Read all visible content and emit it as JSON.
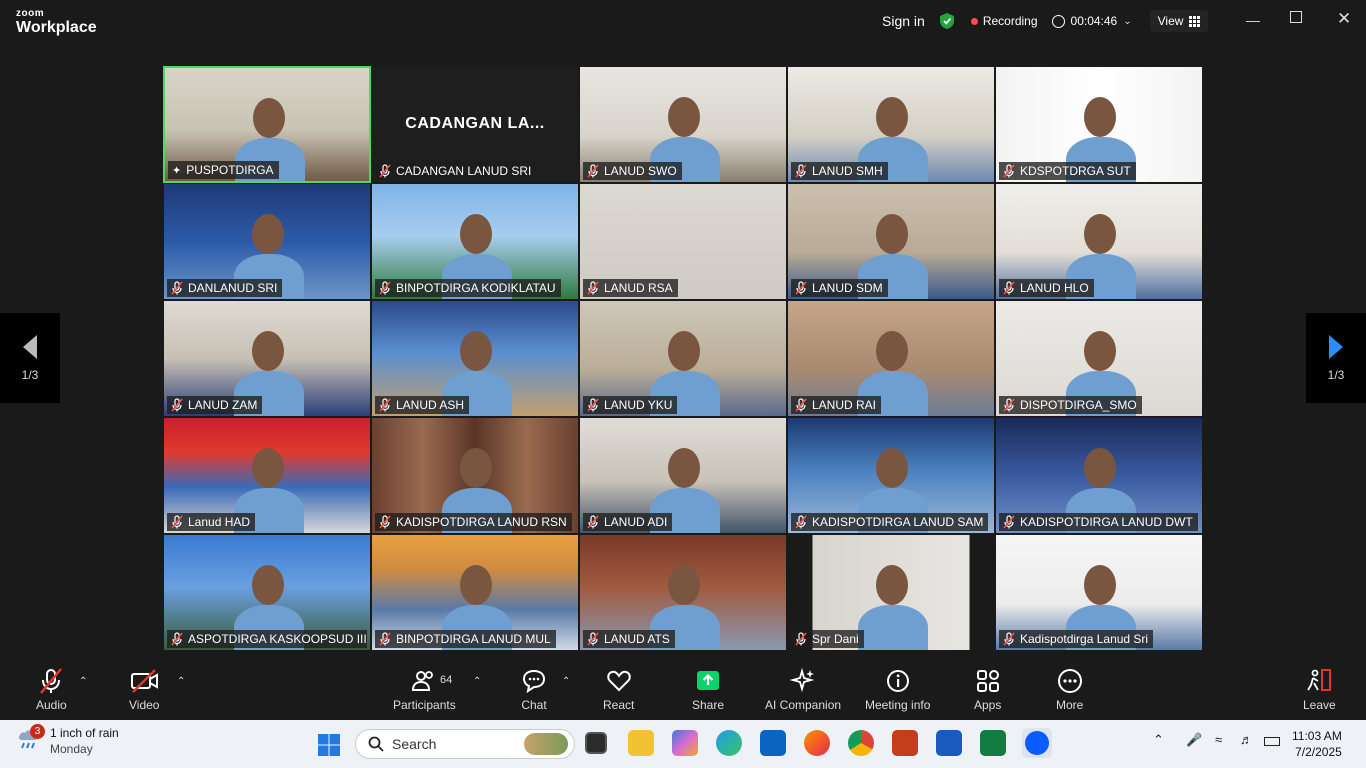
{
  "app": {
    "logo_top": "zoom",
    "logo_bottom": "Workplace"
  },
  "titlebar": {
    "sign_in": "Sign in",
    "recording": "Recording",
    "timer": "00:04:46",
    "view": "View"
  },
  "gallery": {
    "page_left": "1/3",
    "page_right": "1/3",
    "tiles": [
      {
        "name": "PUSPOTDIRGA",
        "pinned": true,
        "active": true
      },
      {
        "name": "CADANGAN LANUD SRI",
        "placeholder": "CADANGAN LA..."
      },
      {
        "name": "LANUD SWO"
      },
      {
        "name": "LANUD SMH"
      },
      {
        "name": "KDSPOTDRGA SUT"
      },
      {
        "name": "DANLANUD SRI"
      },
      {
        "name": "BINPOTDIRGA KODIKLATAU"
      },
      {
        "name": "LANUD RSA"
      },
      {
        "name": "LANUD SDM"
      },
      {
        "name": "LANUD HLO"
      },
      {
        "name": "LANUD ZAM"
      },
      {
        "name": "LANUD ASH"
      },
      {
        "name": "LANUD YKU"
      },
      {
        "name": "LANUD RAI"
      },
      {
        "name": "DISPOTDIRGA_SMO"
      },
      {
        "name": "Lanud HAD"
      },
      {
        "name": "KADISPOTDIRGA LANUD RSN"
      },
      {
        "name": "LANUD ADI"
      },
      {
        "name": "KADISPOTDIRGA LANUD SAM"
      },
      {
        "name": "KADISPOTDIRGA LANUD DWT"
      },
      {
        "name": "ASPOTDIRGA KASKOOPSUD III..."
      },
      {
        "name": "BINPOTDIRGA LANUD MUL"
      },
      {
        "name": "LANUD ATS"
      },
      {
        "name": "Spr Dani"
      },
      {
        "name": "Kadispotdirga Lanud Sri"
      }
    ]
  },
  "toolbar": {
    "audio": "Audio",
    "video": "Video",
    "participants": "Participants",
    "participant_count": "64",
    "chat": "Chat",
    "react": "React",
    "share": "Share",
    "ai_companion": "AI Companion",
    "meeting_info": "Meeting info",
    "apps": "Apps",
    "more": "More",
    "leave": "Leave"
  },
  "taskbar": {
    "weather_badge": "3",
    "weather_line1": "1 inch of rain",
    "weather_line2": "Monday",
    "search": "Search",
    "time": "11:03 AM",
    "date": "7/2/2025"
  },
  "colors": {
    "active_border": "#4cd964",
    "share_green": "#0bd26a",
    "recording_red": "#ff4d4d"
  }
}
